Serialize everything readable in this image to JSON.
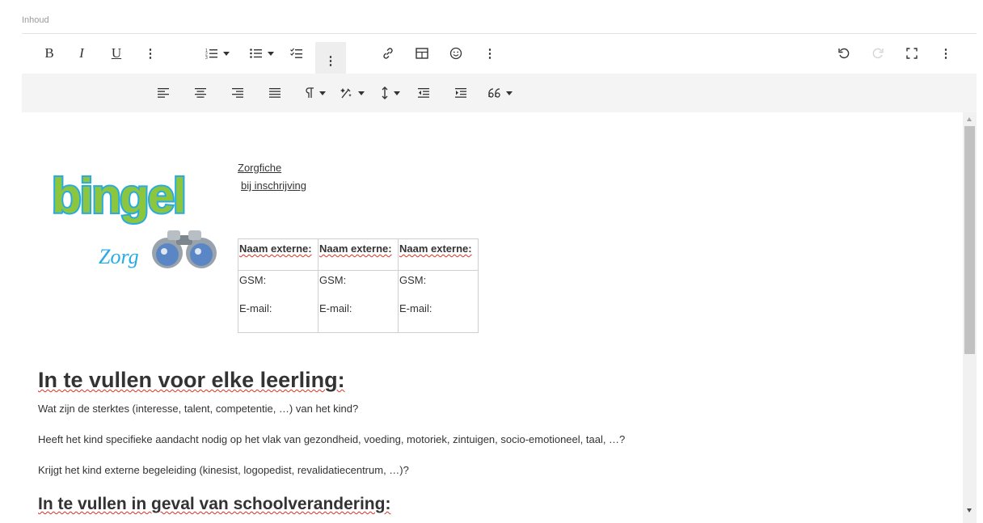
{
  "field": {
    "label": "Inhoud"
  },
  "toolbar": {
    "bold": "B",
    "italic": "I",
    "underline": "U",
    "more": "⋮"
  },
  "document": {
    "logo": {
      "brand": "bingel",
      "sub": "Zorg"
    },
    "title_line1": "Zorgfiche",
    "title_line2": "bij inschrijving",
    "table": {
      "headers": [
        "Naam externe:",
        "Naam externe:",
        "Naam externe:"
      ],
      "gsm": [
        "GSM:",
        "GSM:",
        "GSM:"
      ],
      "email": [
        "E-mail:",
        "E-mail:",
        "E-mail:"
      ]
    },
    "heading1": "In te vullen voor elke leerling:",
    "paragraphs": [
      "Wat zijn de sterktes (interesse, talent, competentie, …) van het kind?",
      "Heeft het kind specifieke aandacht nodig op het vlak van gezondheid, voeding, motoriek, zintuigen, socio-emotioneel, taal, …?",
      "Krijgt het kind externe begeleiding (kinesist, logopedist, revalidatiecentrum, …)?"
    ],
    "heading2": "In te vullen in geval van schoolverandering:"
  },
  "colors": {
    "toolbar_secondary_bg": "#f4f4f4",
    "spell_underline": "#d93025",
    "logo_green": "#8cc63f",
    "logo_blue": "#29abe2"
  },
  "icons": [
    "bold-icon",
    "italic-icon",
    "underline-icon",
    "more-vertical-icon",
    "ordered-list-icon",
    "bullet-list-icon",
    "checklist-icon",
    "link-icon",
    "table-icon",
    "emoji-icon",
    "undo-icon",
    "redo-icon",
    "fullscreen-icon",
    "align-left-icon",
    "align-center-icon",
    "align-right-icon",
    "justify-icon",
    "paragraph-format-icon",
    "clear-format-icon",
    "line-height-icon",
    "outdent-icon",
    "indent-icon",
    "quote-icon"
  ]
}
